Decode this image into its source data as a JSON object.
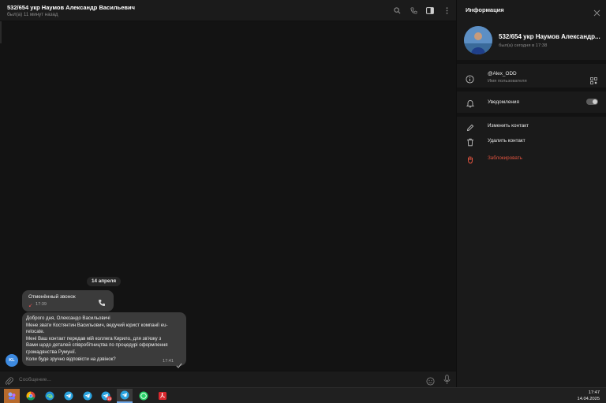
{
  "chat": {
    "title": "532/654 укр Наумов Александр Васильевич",
    "status": "был(а) 11 минут назад",
    "date_chip": "14 апреля",
    "call": {
      "title": "Отменённый звонок",
      "time": "17:39"
    },
    "message": {
      "lines": [
        "Доброго дня, Олександо Васильовичі",
        "Мене звати Костянтин Васильович, ведучий юрист компанії eu-",
        "relocate.",
        "Мені Ваш контакт передав мій коллега Кирило, для зв'язку з",
        "Вами щодо деталей співробітництва по процедурі оформлення",
        "громадянства Румунії.",
        "Коли буде зручно відповісти на дзвінок?"
      ],
      "time": "17:41"
    },
    "avatar_initials": "KL",
    "composer_placeholder": "Сообщение..."
  },
  "info": {
    "title": "Информация",
    "name": "532/654 укр Наумов Александр...",
    "status": "был(а) сегодня в 17:38",
    "username": "@Alex_ODD",
    "username_label": "Имя пользователя",
    "notifications_label": "Уведомления",
    "notifications_on": true,
    "actions": [
      {
        "label": "Изменить контакт"
      },
      {
        "label": "Удалить контакт"
      },
      {
        "label": "Заблокировать"
      }
    ]
  },
  "taskbar": {
    "badge_count": "15",
    "time": "17:47",
    "date": "14.04.2025"
  },
  "colors": {
    "accent": "#6fa7e6",
    "danger": "#e0533f",
    "bubble": "#3b3b3b"
  }
}
